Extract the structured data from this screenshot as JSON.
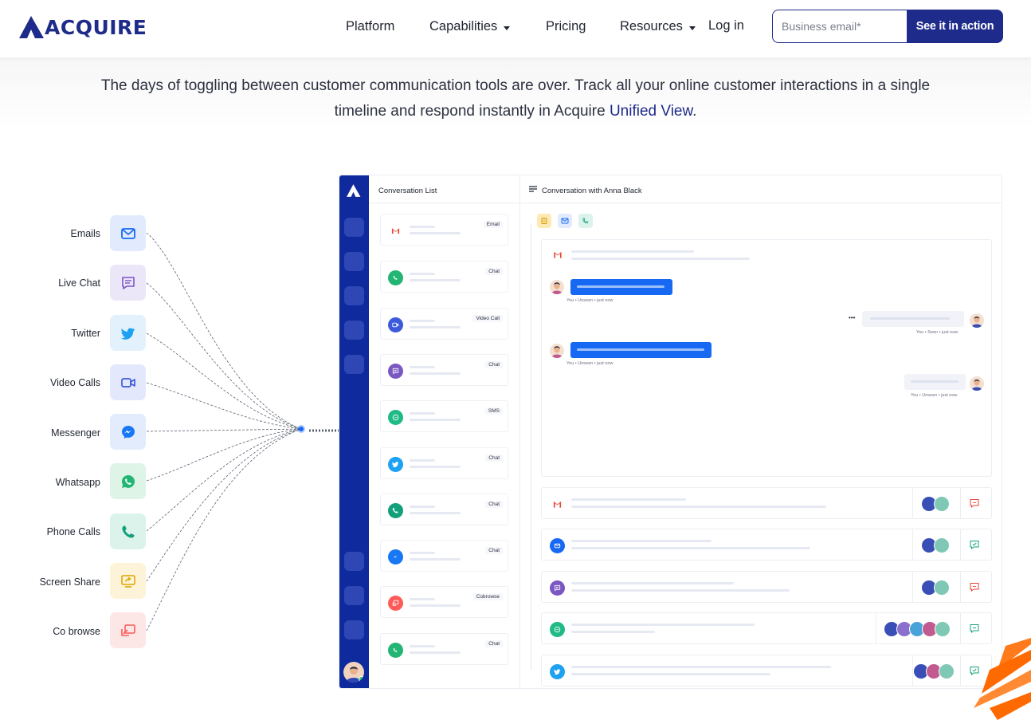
{
  "nav": {
    "brand": "ACQUIRE",
    "links": [
      "Platform",
      "Capabilities",
      "Pricing",
      "Resources",
      "Log in"
    ],
    "email_placeholder": "Business email*",
    "cta": "See it in action"
  },
  "intro": {
    "text": "The days of toggling between customer communication tools are over. Track all your online customer interactions in a single timeline and respond instantly in Acquire ",
    "link": "Unified View",
    "tail": "."
  },
  "channels": [
    "Emails",
    "Live Chat",
    "Twitter",
    "Video Calls",
    "Messenger",
    "Whatsapp",
    "Phone Calls",
    "Screen Share",
    "Co browse"
  ],
  "icons": {
    "Emails": "envelope-icon",
    "Live Chat": "chat-bubble-icon",
    "Twitter": "twitter-icon",
    "Video Calls": "video-camera-icon",
    "Messenger": "messenger-icon",
    "Whatsapp": "whatsapp-icon",
    "Phone Calls": "phone-icon",
    "Screen Share": "screen-share-icon",
    "Co browse": "cobrowse-icon"
  },
  "colors": {
    "brand": "#1e2b8a",
    "rail": "#0e2a9c",
    "accent_blue": "#1769f3",
    "gmail_red": "#ea4335",
    "whatsapp_green": "#22b573",
    "chat_purple": "#7b57c2",
    "twitter_blue": "#1da1f2",
    "cobrowse_red": "#ff5a5a"
  },
  "app": {
    "list_title": "Conversation List",
    "chat_title": "Conversation with Anna Black",
    "conversations": [
      "Email",
      "Chat",
      "Video Call",
      "Chat",
      "SMS",
      "Chat",
      "Chat",
      "Chat",
      "Cobrowse",
      "Chat"
    ],
    "meta_unseen": "You • Unseen • just now",
    "meta_seen": "You • Seen • just now",
    "more": "•••"
  }
}
